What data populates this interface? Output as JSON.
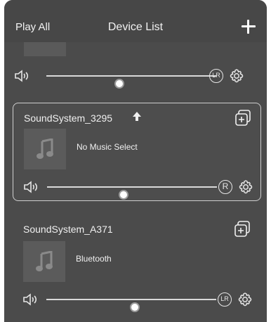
{
  "header": {
    "play_all": "Play All",
    "title": "Device List",
    "add_icon": "plus-icon"
  },
  "devices": [
    {
      "name": "",
      "music": "",
      "volume": 0.43,
      "channel": "LR"
    },
    {
      "name": "SoundSystem_3295",
      "music": "No Music Select",
      "volume": 0.45,
      "channel": "R",
      "selected": true,
      "master_icon": "up-arrow-icon"
    },
    {
      "name": "SoundSystem_A371",
      "music": "Bluetooth",
      "volume": 0.52,
      "channel": "LR"
    }
  ],
  "colors": {
    "background": "#4b4b4b",
    "selected_border": "#cfcfcf",
    "text": "#f0f0f0"
  }
}
